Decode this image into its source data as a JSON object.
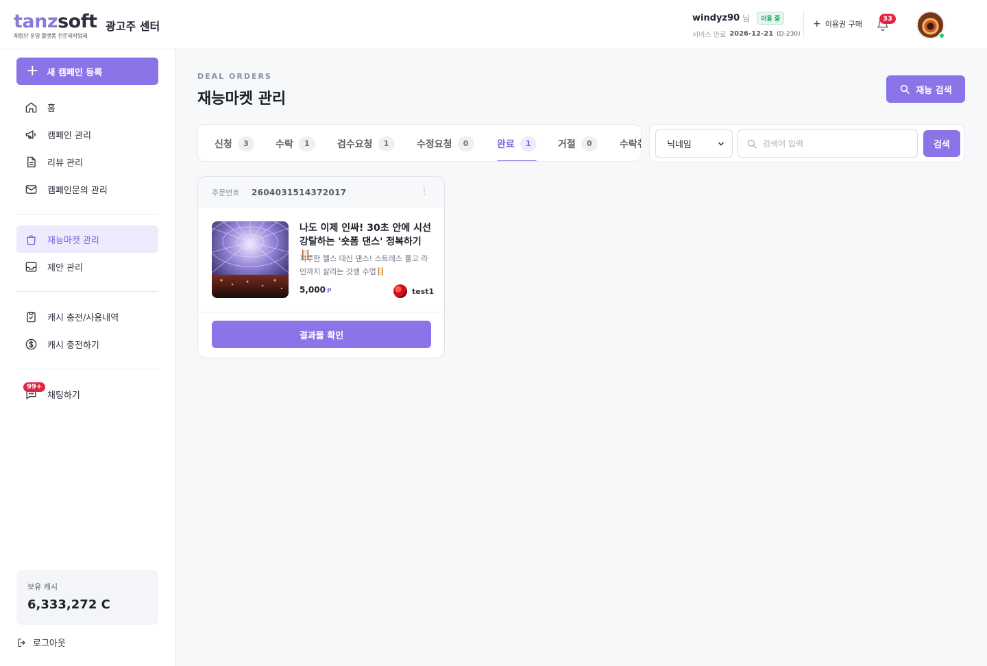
{
  "header": {
    "logo_part1": "tanz",
    "logo_part2": "soft",
    "logo_tagline": "체험단 운영 플랫폼 전문제작업체",
    "center_title": "광고주 센터",
    "username": "windyz90",
    "honorific": "님",
    "status": "이용 중",
    "service_label": "서비스 만료",
    "service_date": "2026-12-21",
    "service_dday": "(D-230)",
    "buy_label": "이용권 구매",
    "notification_count": "33"
  },
  "sidebar": {
    "new_campaign": "새 캠페인 등록",
    "items": [
      {
        "label": "홈",
        "icon": "home-icon"
      },
      {
        "label": "캠페인 관리",
        "icon": "megaphone-icon"
      },
      {
        "label": "리뷰 관리",
        "icon": "document-icon"
      },
      {
        "label": "캠페인문의 관리",
        "icon": "mail-icon"
      },
      {
        "label": "재능마켓 관리",
        "icon": "shopping-bag-icon"
      },
      {
        "label": "제안 관리",
        "icon": "inbox-icon"
      },
      {
        "label": "캐시 충전/사용내역",
        "icon": "clipboard-check-icon"
      },
      {
        "label": "캐시 충전하기",
        "icon": "dollar-circle-icon"
      },
      {
        "label": "채팅하기",
        "icon": "chat-icon"
      }
    ],
    "chat_badge": "99+",
    "cash_label": "보유 캐시",
    "cash_value": "6,333,272 C",
    "logout": "로그아웃"
  },
  "main": {
    "eyebrow": "DEAL ORDERS",
    "title": "재능마켓 관리",
    "talent_search": "재능 검색",
    "tabs": [
      {
        "label": "신청",
        "count": "3"
      },
      {
        "label": "수락",
        "count": "1"
      },
      {
        "label": "검수요청",
        "count": "1"
      },
      {
        "label": "수정요청",
        "count": "0"
      },
      {
        "label": "완료",
        "count": "1"
      },
      {
        "label": "거절",
        "count": "0"
      },
      {
        "label": "수락취",
        "count": ""
      }
    ],
    "search": {
      "select_value": "닉네임",
      "placeholder": "검색어 입력",
      "button": "검색"
    },
    "order": {
      "order_label": "주문번호",
      "order_no": "2604031514372017",
      "title": "나도 이제 인싸! 30초 안에 시선 강탈하는 '숏폼 댄스' 정복하기 🪜",
      "desc": "지루한 헬스 대신 댄스! 스트레스 풀고 라인까지 살리는 갓생 수업🪜",
      "price": "5,000",
      "price_unit": "P",
      "seller": "test1",
      "result_button": "결과물 확인"
    }
  },
  "colors": {
    "accent": "#8b74e8",
    "accent_text": "#7a63df",
    "badge_red": "#e5243f",
    "online_green": "#22c55e"
  }
}
